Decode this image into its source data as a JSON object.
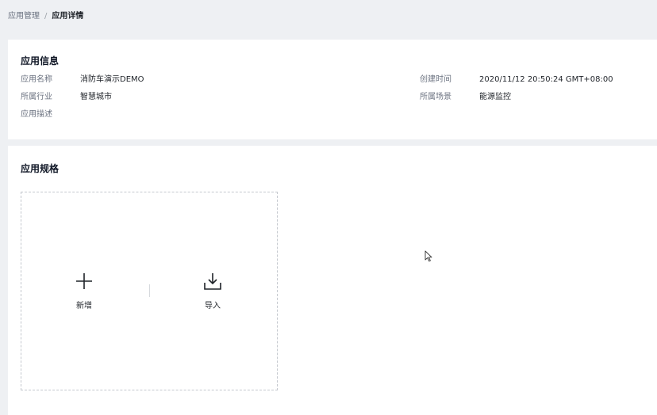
{
  "breadcrumb": {
    "parent": "应用管理",
    "separator": "/",
    "current": "应用详情"
  },
  "app_info": {
    "title": "应用信息",
    "fields": {
      "name": {
        "label": "应用名称",
        "value": "消防车演示DEMO"
      },
      "industry": {
        "label": "所属行业",
        "value": "智慧城市"
      },
      "description": {
        "label": "应用描述",
        "value": ""
      },
      "created_at": {
        "label": "创建时间",
        "value": "2020/11/12 20:50:24 GMT+08:00"
      },
      "scenario": {
        "label": "所属场景",
        "value": "能源监控"
      }
    }
  },
  "app_spec": {
    "title": "应用规格",
    "actions": {
      "add": {
        "label": "新增",
        "icon": "plus-icon"
      },
      "import": {
        "label": "导入",
        "icon": "download-icon"
      }
    }
  }
}
